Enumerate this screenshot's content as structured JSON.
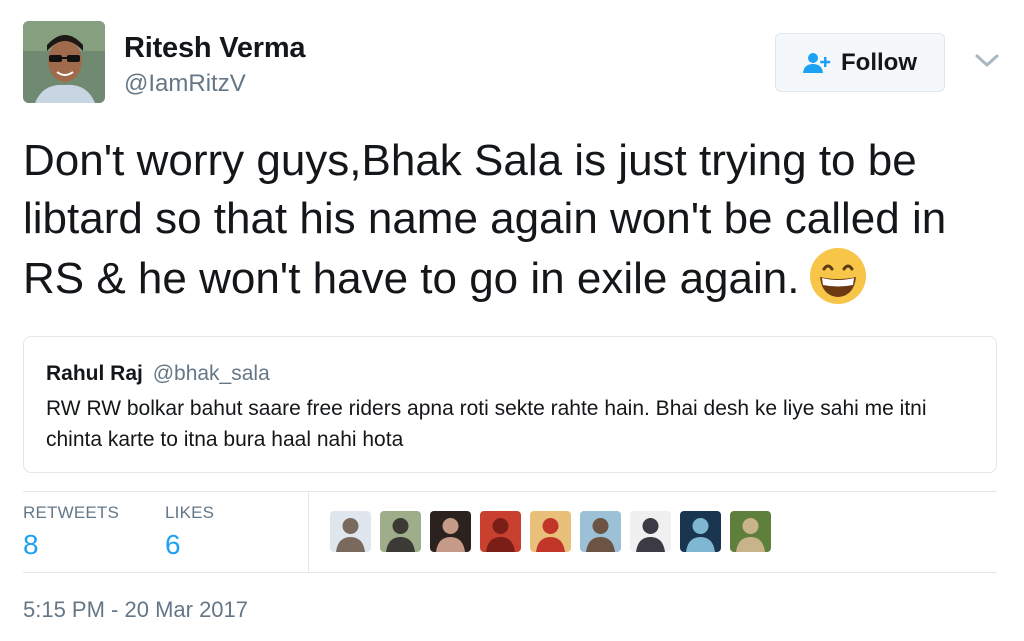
{
  "author": {
    "name": "Ritesh Verma",
    "handle": "@IamRitzV"
  },
  "follow_button": {
    "label": "Follow",
    "icon": "add-user-icon"
  },
  "menu_icon": "chevron-down-icon",
  "tweet": {
    "text": "Don't worry guys,Bhak Sala is just trying to be libtard so that his name again won't be called in RS & he won't have to go in exile again.",
    "emoji": "grinning-face-emoji"
  },
  "quoted_tweet": {
    "name": "Rahul Raj",
    "handle": "@bhak_sala",
    "text": "RW RW bolkar bahut saare free riders apna roti sekte rahte hain. Bhai desh ke liye sahi me itni chinta karte to itna bura haal nahi hota"
  },
  "stats": {
    "retweets_label": "RETWEETS",
    "retweets_count": "8",
    "likes_label": "LIKES",
    "likes_count": "6"
  },
  "likers": [
    {
      "id": "liker-1",
      "colors": [
        "#dfe6ee",
        "#7a6a5e"
      ]
    },
    {
      "id": "liker-2",
      "colors": [
        "#9fae8a",
        "#3b3a34"
      ]
    },
    {
      "id": "liker-3",
      "colors": [
        "#2b2220",
        "#c59a86"
      ]
    },
    {
      "id": "liker-4",
      "colors": [
        "#c9402e",
        "#7a1f17"
      ]
    },
    {
      "id": "liker-5",
      "colors": [
        "#e8c07a",
        "#c2362a"
      ]
    },
    {
      "id": "liker-6",
      "colors": [
        "#9cc0d6",
        "#6b5444"
      ]
    },
    {
      "id": "liker-7",
      "colors": [
        "#f0f0f0",
        "#3c3a44"
      ]
    },
    {
      "id": "liker-8",
      "colors": [
        "#1a3550",
        "#7fb7d3"
      ]
    },
    {
      "id": "liker-9",
      "colors": [
        "#5f7f3c",
        "#c9b38a"
      ]
    }
  ],
  "timestamp": "5:15 PM - 20 Mar 2017",
  "colors": {
    "accent": "#1da1f2",
    "secondary_text": "#657786",
    "border": "#e1e8ed"
  }
}
